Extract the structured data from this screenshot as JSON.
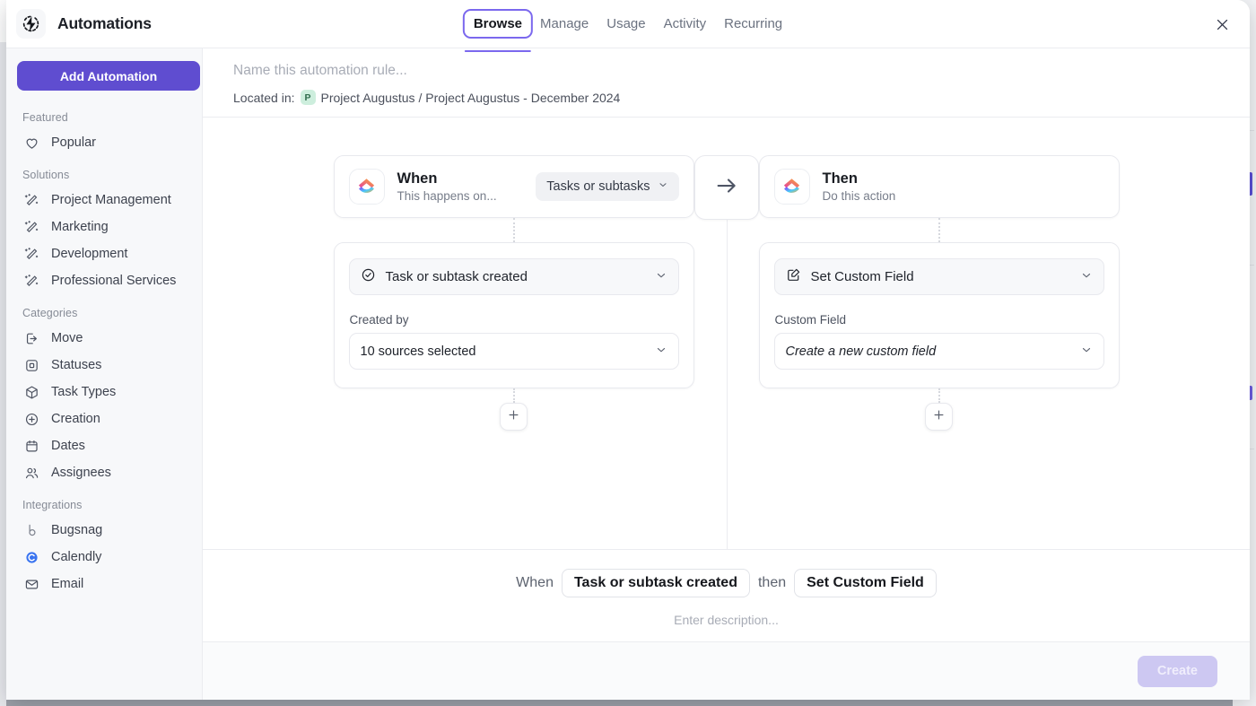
{
  "window": {
    "brand_title": "Automations",
    "brand_icon": "automations-bolt-icon",
    "close_icon": "close-icon"
  },
  "tabs": [
    {
      "label": "Browse",
      "active": true
    },
    {
      "label": "Manage",
      "active": false
    },
    {
      "label": "Usage",
      "active": false
    },
    {
      "label": "Activity",
      "active": false
    },
    {
      "label": "Recurring",
      "active": false
    }
  ],
  "sidebar": {
    "add_button": "Add Automation",
    "groups": [
      {
        "title": "Featured",
        "items": [
          {
            "label": "Popular",
            "icon": "heart-icon"
          }
        ]
      },
      {
        "title": "Solutions",
        "items": [
          {
            "label": "Project Management",
            "icon": "magic-wand-icon"
          },
          {
            "label": "Marketing",
            "icon": "magic-wand-icon"
          },
          {
            "label": "Development",
            "icon": "magic-wand-icon"
          },
          {
            "label": "Professional Services",
            "icon": "magic-wand-icon"
          }
        ]
      },
      {
        "title": "Categories",
        "items": [
          {
            "label": "Move",
            "icon": "move-arrow-icon"
          },
          {
            "label": "Statuses",
            "icon": "square-nested-icon"
          },
          {
            "label": "Task Types",
            "icon": "cube-icon"
          },
          {
            "label": "Creation",
            "icon": "plus-circle-icon"
          },
          {
            "label": "Dates",
            "icon": "calendar-icon"
          },
          {
            "label": "Assignees",
            "icon": "people-icon"
          }
        ]
      },
      {
        "title": "Integrations",
        "items": [
          {
            "label": "Bugsnag",
            "icon": "bugsnag-icon"
          },
          {
            "label": "Calendly",
            "icon": "calendly-icon"
          },
          {
            "label": "Email",
            "icon": "envelope-icon"
          }
        ]
      }
    ]
  },
  "rule": {
    "name_placeholder": "Name this automation rule...",
    "located_label": "Located in:",
    "project_badge": "P",
    "location_path": "Project Augustus / Project Augustus - December 2024"
  },
  "flow": {
    "when": {
      "app_icon": "clickup-logo-icon",
      "title": "When",
      "subtitle": "This happens on...",
      "scope_pill": "Tasks or subtasks",
      "trigger": "Task or subtask created",
      "trigger_icon": "check-circle-icon",
      "field_label": "Created by",
      "field_value": "10 sources selected",
      "add_icon": "plus-icon"
    },
    "arrow_icon": "arrow-right-icon",
    "then": {
      "app_icon": "clickup-logo-icon",
      "title": "Then",
      "subtitle": "Do this action",
      "action": "Set Custom Field",
      "action_icon": "edit-square-icon",
      "field_label": "Custom Field",
      "field_value": "Create a new custom field",
      "add_icon": "plus-icon"
    }
  },
  "summary": {
    "when_word": "When",
    "when_chip": "Task or subtask created",
    "then_word": "then",
    "then_chip": "Set Custom Field",
    "description_placeholder": "Enter description..."
  },
  "footer": {
    "create_label": "Create"
  },
  "colors": {
    "accent_purple": "#5f4dd0",
    "tab_underline": "#7b68ee",
    "create_disabled": "#cdc8f2",
    "project_badge_bg": "#cdeedd"
  }
}
